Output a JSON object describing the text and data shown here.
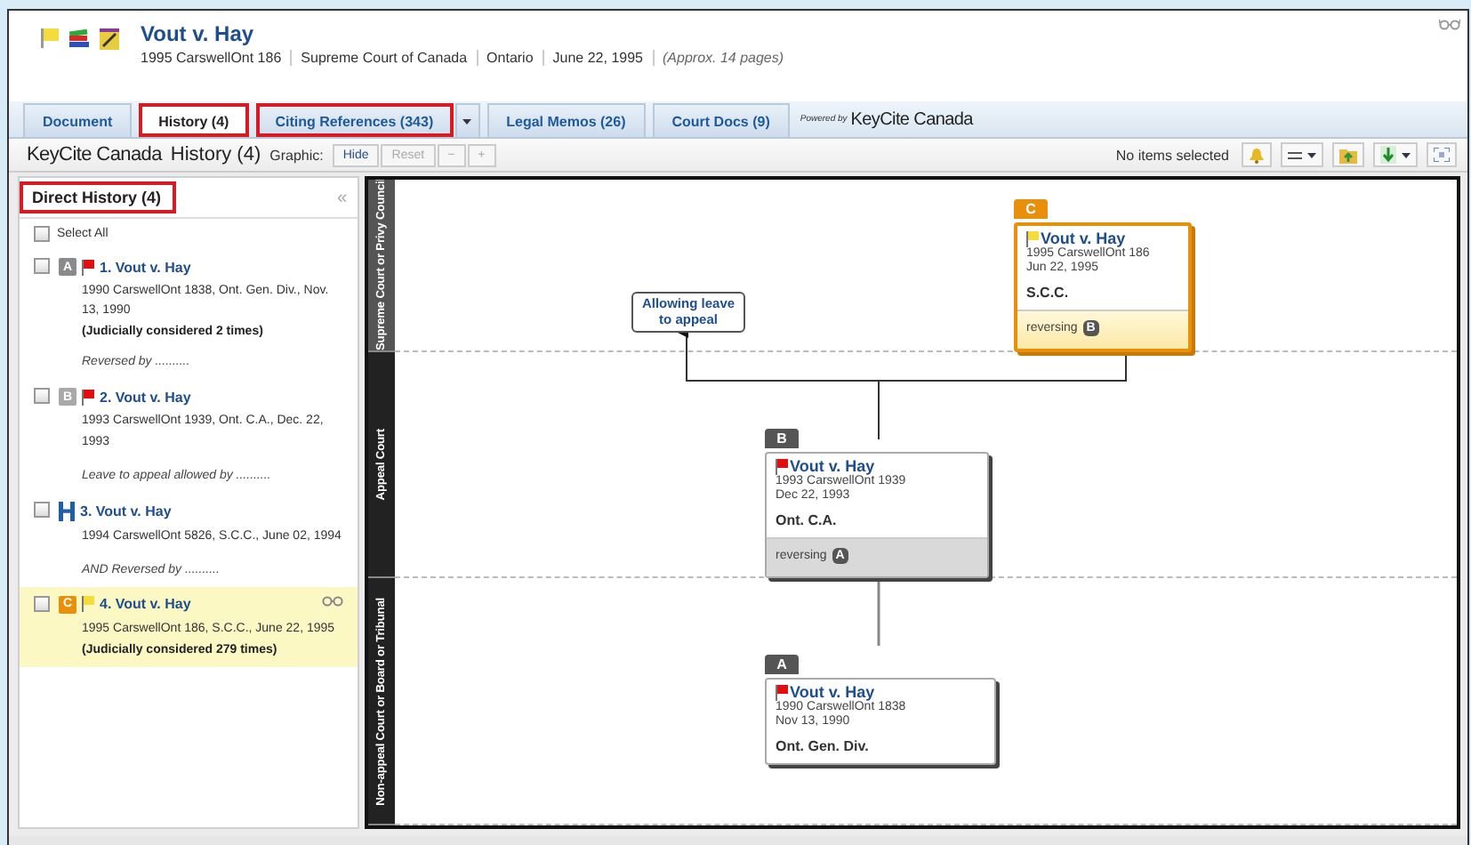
{
  "document": {
    "title": "Vout v. Hay",
    "meta": [
      "1995 CarswellOnt 186",
      "Supreme Court of Canada",
      "Ontario",
      "June 22, 1995"
    ],
    "pages_note": "(Approx. 14 pages)"
  },
  "tabs": [
    {
      "label": "Document",
      "selected": false,
      "highlighted": false,
      "has_menu": false
    },
    {
      "label": "History (4)",
      "selected": true,
      "highlighted": true,
      "has_menu": false
    },
    {
      "label": "Citing References (343)",
      "selected": false,
      "highlighted": true,
      "has_menu": true
    },
    {
      "label": "Legal Memos (26)",
      "selected": false,
      "highlighted": false,
      "has_menu": false
    },
    {
      "label": "Court Docs (9)",
      "selected": false,
      "highlighted": false,
      "has_menu": false
    }
  ],
  "powered_by": {
    "label": "Powered by",
    "logo": "KeyCite Canada"
  },
  "toolbar": {
    "brand": "KeyCite Canada",
    "title": "History (4)",
    "graphic_label": "Graphic:",
    "buttons": [
      {
        "label": "Hide",
        "disabled": false
      },
      {
        "label": "Reset",
        "disabled": true
      },
      {
        "label": "−",
        "disabled": true
      },
      {
        "label": "+",
        "disabled": true
      }
    ],
    "status": "No items selected"
  },
  "history_panel": {
    "title": "Direct History (4)",
    "highlighted": true,
    "collapse": "«",
    "select_all": {
      "label": "Select All",
      "checked": false
    },
    "items": [
      {
        "badge": "A",
        "color": "#8a8a8a",
        "kind": "red_flag",
        "title": "1. Vout v. Hay",
        "citation": "1990 CarswellOnt 1838, Ont. Gen. Div., Nov. 13, 1990",
        "note": "(Judicially considered 2 times)",
        "relation": "Reversed by ..........",
        "checked": false,
        "selected": false,
        "viewing": false
      },
      {
        "badge": "B",
        "color": "#a9a9a9",
        "kind": "red_flag",
        "title": "2. Vout v. Hay",
        "citation": "1993 CarswellOnt 1939, Ont. C.A., Dec. 22, 1993",
        "relation": "Leave to appeal allowed by ..........",
        "checked": false,
        "selected": false,
        "viewing": false
      },
      {
        "kind": "history",
        "title": "3. Vout v. Hay",
        "citation": "1994 CarswellOnt 5826, S.C.C., June 02, 1994",
        "relation": "AND Reversed by ..........",
        "checked": false,
        "selected": false,
        "viewing": false
      },
      {
        "badge": "C",
        "color": "#e8900c",
        "kind": "yellow_flag",
        "title": "4. Vout v. Hay",
        "citation": "1995 CarswellOnt 186, S.C.C., June 22, 1995",
        "note": "(Judicially considered 279 times)",
        "checked": false,
        "selected": true,
        "viewing": true
      }
    ]
  },
  "graph": {
    "lanes": [
      "Supreme Court or Privy Council",
      "Appeal Court",
      "Non-appeal Court or Board or Tribunal"
    ],
    "annotation": "Allowing leave to appeal",
    "nodes": [
      {
        "letter": "C",
        "kind": "yellow_flag",
        "title": "Vout v. Hay",
        "citation": "1995 CarswellOnt 186",
        "date": "Jun 22, 1995",
        "court": "S.C.C.",
        "relation": "reversing",
        "relation_ref": "B",
        "current": true
      },
      {
        "letter": "B",
        "kind": "red_flag",
        "title": "Vout v. Hay",
        "citation": "1993 CarswellOnt 1939",
        "date": "Dec 22, 1993",
        "court": "Ont. C.A.",
        "relation": "reversing",
        "relation_ref": "A",
        "current": false
      },
      {
        "letter": "A",
        "kind": "red_flag",
        "title": "Vout v. Hay",
        "citation": "1990 CarswellOnt 1838",
        "date": "Nov 13, 1990",
        "court": "Ont. Gen. Div.",
        "current": false
      }
    ]
  }
}
